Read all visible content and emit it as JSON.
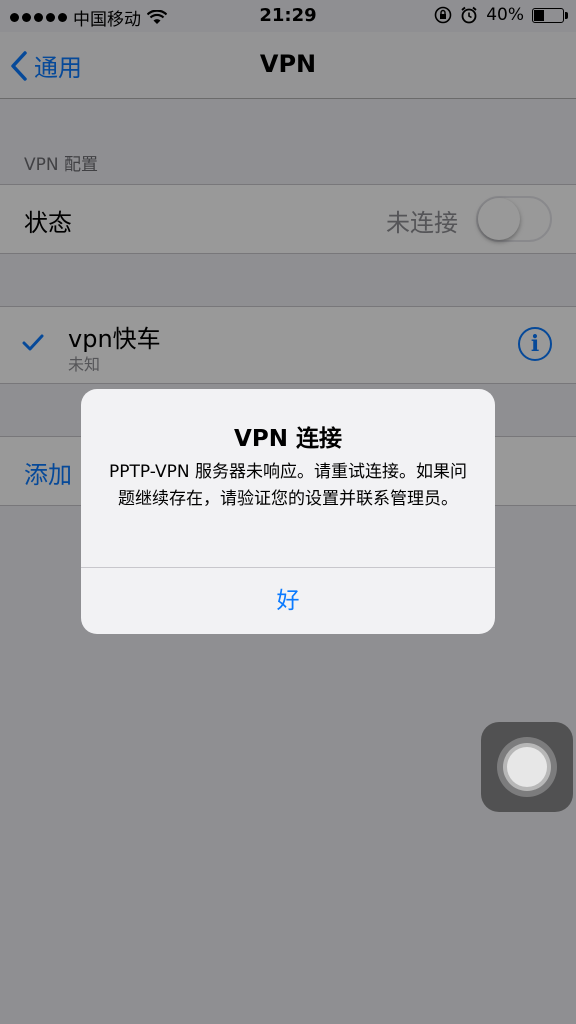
{
  "status_bar": {
    "carrier": "中国移动",
    "time": "21:29",
    "battery": "40%",
    "battery_level": 0.4
  },
  "nav": {
    "back_label": "通用",
    "title": "VPN"
  },
  "section": {
    "header": "VPN 配置"
  },
  "status_row": {
    "label": "状态",
    "value": "未连接",
    "toggle_on": false
  },
  "vpn_item": {
    "name": "vpn快车",
    "subtitle": "未知",
    "selected": true
  },
  "add_row": {
    "label": "添加"
  },
  "alert": {
    "title": "VPN 连接",
    "message": "PPTP-VPN 服务器未响应。请重试连接。如果问题继续存在，请验证您的设置并联系管理员。",
    "ok_label": "好"
  },
  "colors": {
    "accent": "#0a7aff"
  },
  "icons": {
    "signal": "signal-dots-icon",
    "wifi": "wifi-icon",
    "rotation_lock": "rotation-lock-icon",
    "alarm": "alarm-icon",
    "battery": "battery-icon",
    "back": "chevron-left-icon",
    "check": "checkmark-icon",
    "info": "info-icon",
    "assistive": "assistive-touch-icon"
  }
}
